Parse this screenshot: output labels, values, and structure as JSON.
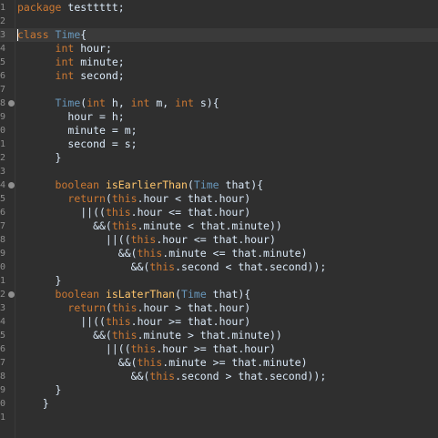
{
  "editor": {
    "lines": [
      {
        "n": "1",
        "fold": false,
        "current": false,
        "tokens": [
          {
            "t": "package ",
            "c": "kw"
          },
          {
            "t": "testtttt;",
            "c": "pl"
          }
        ]
      },
      {
        "n": "2",
        "fold": false,
        "current": false,
        "tokens": []
      },
      {
        "n": "3",
        "fold": false,
        "current": true,
        "tokens": [
          {
            "t": "class ",
            "c": "kw"
          },
          {
            "t": "Time",
            "c": "ty"
          },
          {
            "t": "{",
            "c": "pl"
          }
        ]
      },
      {
        "n": "4",
        "fold": false,
        "current": false,
        "tokens": [
          {
            "t": "      ",
            "c": "pl"
          },
          {
            "t": "int ",
            "c": "kw"
          },
          {
            "t": "hour;",
            "c": "pl"
          }
        ]
      },
      {
        "n": "5",
        "fold": false,
        "current": false,
        "tokens": [
          {
            "t": "      ",
            "c": "pl"
          },
          {
            "t": "int ",
            "c": "kw"
          },
          {
            "t": "minute;",
            "c": "pl"
          }
        ]
      },
      {
        "n": "6",
        "fold": false,
        "current": false,
        "tokens": [
          {
            "t": "      ",
            "c": "pl"
          },
          {
            "t": "int ",
            "c": "kw"
          },
          {
            "t": "second;",
            "c": "pl"
          }
        ]
      },
      {
        "n": "7",
        "fold": false,
        "current": false,
        "tokens": []
      },
      {
        "n": "8",
        "fold": true,
        "current": false,
        "tokens": [
          {
            "t": "      ",
            "c": "pl"
          },
          {
            "t": "Time",
            "c": "ty"
          },
          {
            "t": "(",
            "c": "pl"
          },
          {
            "t": "int ",
            "c": "kw"
          },
          {
            "t": "h, ",
            "c": "pl"
          },
          {
            "t": "int ",
            "c": "kw"
          },
          {
            "t": "m, ",
            "c": "pl"
          },
          {
            "t": "int ",
            "c": "kw"
          },
          {
            "t": "s){",
            "c": "pl"
          }
        ]
      },
      {
        "n": "9",
        "fold": false,
        "current": false,
        "tokens": [
          {
            "t": "        hour = h;",
            "c": "pl"
          }
        ]
      },
      {
        "n": "0",
        "fold": false,
        "current": false,
        "tokens": [
          {
            "t": "        minute = m;",
            "c": "pl"
          }
        ]
      },
      {
        "n": "1",
        "fold": false,
        "current": false,
        "tokens": [
          {
            "t": "        second = s;",
            "c": "pl"
          }
        ]
      },
      {
        "n": "2",
        "fold": false,
        "current": false,
        "tokens": [
          {
            "t": "      }",
            "c": "pl"
          }
        ]
      },
      {
        "n": "3",
        "fold": false,
        "current": false,
        "tokens": []
      },
      {
        "n": "4",
        "fold": true,
        "current": false,
        "tokens": [
          {
            "t": "      ",
            "c": "pl"
          },
          {
            "t": "boolean ",
            "c": "kw"
          },
          {
            "t": "isEarlierThan",
            "c": "fn"
          },
          {
            "t": "(",
            "c": "pl"
          },
          {
            "t": "Time ",
            "c": "ty"
          },
          {
            "t": "that){",
            "c": "pl"
          }
        ]
      },
      {
        "n": "5",
        "fold": false,
        "current": false,
        "tokens": [
          {
            "t": "        ",
            "c": "pl"
          },
          {
            "t": "return",
            "c": "kw"
          },
          {
            "t": "(",
            "c": "pl"
          },
          {
            "t": "this",
            "c": "th"
          },
          {
            "t": ".hour < that.hour)",
            "c": "pl"
          }
        ]
      },
      {
        "n": "6",
        "fold": false,
        "current": false,
        "tokens": [
          {
            "t": "          ||((",
            "c": "pl"
          },
          {
            "t": "this",
            "c": "th"
          },
          {
            "t": ".hour <= that.hour)",
            "c": "pl"
          }
        ]
      },
      {
        "n": "7",
        "fold": false,
        "current": false,
        "tokens": [
          {
            "t": "            &&(",
            "c": "pl"
          },
          {
            "t": "this",
            "c": "th"
          },
          {
            "t": ".minute < that.minute))",
            "c": "pl"
          }
        ]
      },
      {
        "n": "8",
        "fold": false,
        "current": false,
        "tokens": [
          {
            "t": "              ||((",
            "c": "pl"
          },
          {
            "t": "this",
            "c": "th"
          },
          {
            "t": ".hour <= that.hour)",
            "c": "pl"
          }
        ]
      },
      {
        "n": "9",
        "fold": false,
        "current": false,
        "tokens": [
          {
            "t": "                &&(",
            "c": "pl"
          },
          {
            "t": "this",
            "c": "th"
          },
          {
            "t": ".minute <= that.minute)",
            "c": "pl"
          }
        ]
      },
      {
        "n": "0",
        "fold": false,
        "current": false,
        "tokens": [
          {
            "t": "                  &&(",
            "c": "pl"
          },
          {
            "t": "this",
            "c": "th"
          },
          {
            "t": ".second < that.second));",
            "c": "pl"
          }
        ]
      },
      {
        "n": "1",
        "fold": false,
        "current": false,
        "tokens": [
          {
            "t": "      }",
            "c": "pl"
          }
        ]
      },
      {
        "n": "2",
        "fold": true,
        "current": false,
        "tokens": [
          {
            "t": "      ",
            "c": "pl"
          },
          {
            "t": "boolean ",
            "c": "kw"
          },
          {
            "t": "isLaterThan",
            "c": "fn"
          },
          {
            "t": "(",
            "c": "pl"
          },
          {
            "t": "Time ",
            "c": "ty"
          },
          {
            "t": "that){",
            "c": "pl"
          }
        ]
      },
      {
        "n": "3",
        "fold": false,
        "current": false,
        "tokens": [
          {
            "t": "        ",
            "c": "pl"
          },
          {
            "t": "return",
            "c": "kw"
          },
          {
            "t": "(",
            "c": "pl"
          },
          {
            "t": "this",
            "c": "th"
          },
          {
            "t": ".hour > that.hour)",
            "c": "pl"
          }
        ]
      },
      {
        "n": "4",
        "fold": false,
        "current": false,
        "tokens": [
          {
            "t": "          ||((",
            "c": "pl"
          },
          {
            "t": "this",
            "c": "th"
          },
          {
            "t": ".hour >= that.hour)",
            "c": "pl"
          }
        ]
      },
      {
        "n": "5",
        "fold": false,
        "current": false,
        "tokens": [
          {
            "t": "            &&(",
            "c": "pl"
          },
          {
            "t": "this",
            "c": "th"
          },
          {
            "t": ".minute > that.minute))",
            "c": "pl"
          }
        ]
      },
      {
        "n": "6",
        "fold": false,
        "current": false,
        "tokens": [
          {
            "t": "              ||((",
            "c": "pl"
          },
          {
            "t": "this",
            "c": "th"
          },
          {
            "t": ".hour >= that.hour)",
            "c": "pl"
          }
        ]
      },
      {
        "n": "7",
        "fold": false,
        "current": false,
        "tokens": [
          {
            "t": "                &&(",
            "c": "pl"
          },
          {
            "t": "this",
            "c": "th"
          },
          {
            "t": ".minute >= that.minute)",
            "c": "pl"
          }
        ]
      },
      {
        "n": "8",
        "fold": false,
        "current": false,
        "tokens": [
          {
            "t": "                  &&(",
            "c": "pl"
          },
          {
            "t": "this",
            "c": "th"
          },
          {
            "t": ".second > that.second));",
            "c": "pl"
          }
        ]
      },
      {
        "n": "9",
        "fold": false,
        "current": false,
        "tokens": [
          {
            "t": "      }",
            "c": "pl"
          }
        ]
      },
      {
        "n": "0",
        "fold": false,
        "current": false,
        "tokens": [
          {
            "t": "    }",
            "c": "pl"
          }
        ]
      },
      {
        "n": "1",
        "fold": false,
        "current": false,
        "tokens": []
      }
    ]
  },
  "colors": {
    "background": "#2f2f2f",
    "keyword": "#cc7832",
    "type": "#6897bb",
    "method": "#ffc66d",
    "text": "#d9e8f7",
    "line_number": "#8f8f8f"
  }
}
